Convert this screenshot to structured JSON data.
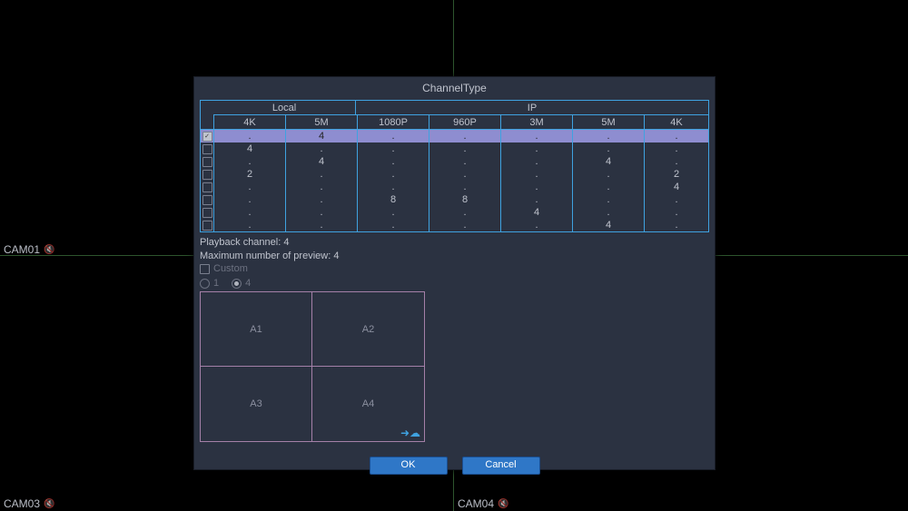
{
  "cameras": {
    "top_left": {
      "label": "CAM01"
    },
    "bottom_left": {
      "label": "CAM03"
    },
    "bottom_right": {
      "label": "CAM04"
    }
  },
  "dialog": {
    "title": "ChannelType",
    "groups": {
      "local": "Local",
      "ip": "IP"
    },
    "columns": [
      "4K",
      "5M",
      "1080P",
      "960P",
      "3M",
      "5M",
      "4K"
    ],
    "rows": [
      {
        "checked": true,
        "cells": [
          ".",
          "4",
          ".",
          ".",
          ".",
          ".",
          "."
        ]
      },
      {
        "checked": false,
        "cells": [
          "4",
          ".",
          ".",
          ".",
          ".",
          ".",
          "."
        ]
      },
      {
        "checked": false,
        "cells": [
          ".",
          "4",
          ".",
          ".",
          ".",
          "4",
          "."
        ]
      },
      {
        "checked": false,
        "cells": [
          "2",
          ".",
          ".",
          ".",
          ".",
          ".",
          "2"
        ]
      },
      {
        "checked": false,
        "cells": [
          ".",
          ".",
          ".",
          ".",
          ".",
          ".",
          "4"
        ]
      },
      {
        "checked": false,
        "cells": [
          ".",
          ".",
          "8",
          "8",
          ".",
          ".",
          "."
        ]
      },
      {
        "checked": false,
        "cells": [
          ".",
          ".",
          ".",
          ".",
          "4",
          ".",
          "."
        ]
      },
      {
        "checked": false,
        "cells": [
          ".",
          ".",
          ".",
          ".",
          ".",
          "4",
          "."
        ]
      }
    ],
    "playback_label": "Playback channel: 4",
    "max_preview_label": "Maximum number of preview: 4",
    "custom_label": "Custom",
    "radio": {
      "opt1": "1",
      "opt4": "4",
      "selected": "4"
    },
    "preview_labels": [
      "A1",
      "A2",
      "A3",
      "A4"
    ],
    "buttons": {
      "ok": "OK",
      "cancel": "Cancel"
    }
  }
}
